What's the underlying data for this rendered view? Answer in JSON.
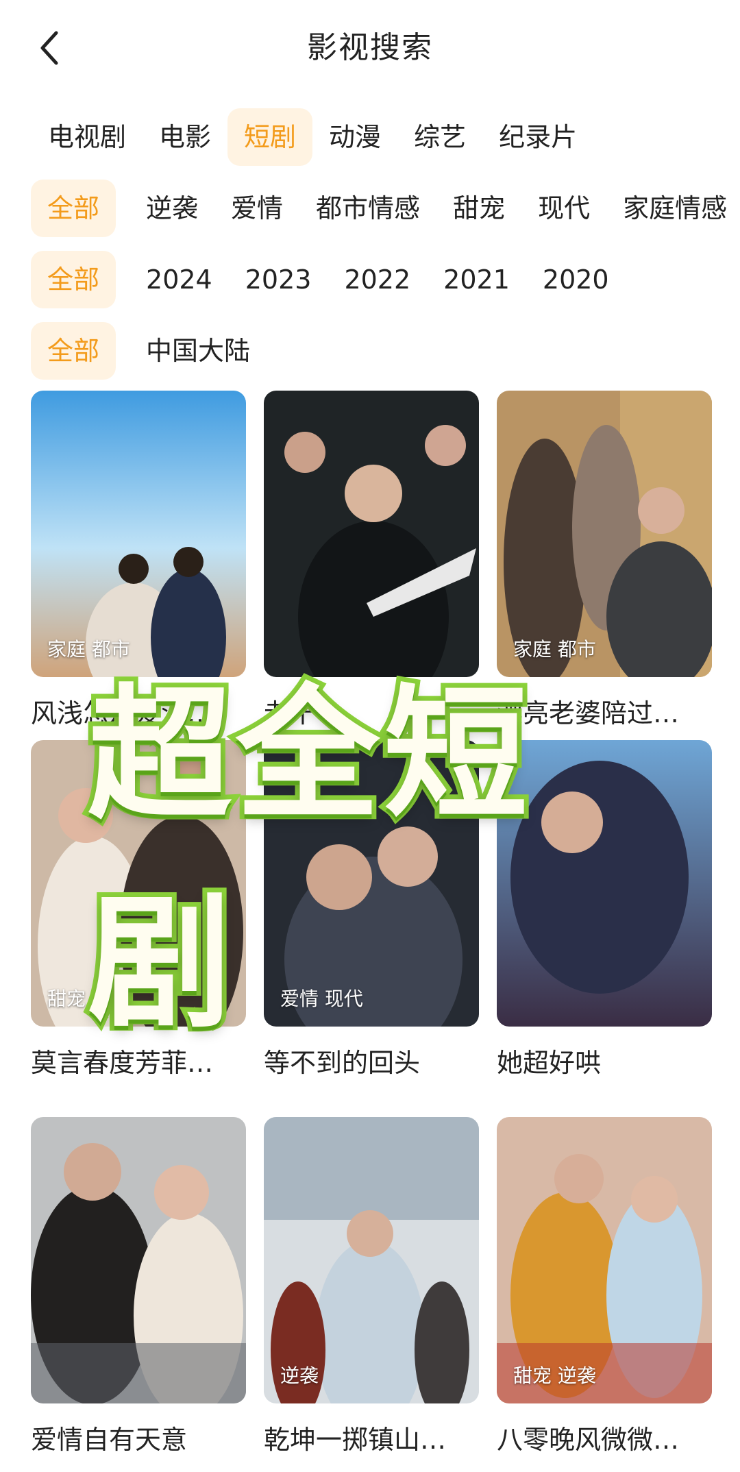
{
  "header": {
    "title": "影视搜索",
    "back_icon": "chevron-left-icon"
  },
  "category_tabs": [
    "电视剧",
    "电影",
    "短剧",
    "动漫",
    "综艺",
    "纪录片"
  ],
  "category_selected": "短剧",
  "genre_filters": [
    "全部",
    "逆袭",
    "爱情",
    "都市情感",
    "甜宠",
    "现代",
    "家庭情感"
  ],
  "year_filters": [
    "全部",
    "2024",
    "2023",
    "2022",
    "2021",
    "2020"
  ],
  "region_filters": [
    "全部",
    "中国大陆"
  ],
  "accent_color": "#f39b1b",
  "items": [
    {
      "title": "风浅怎及爱深…",
      "tags": "家庭 都市"
    },
    {
      "title": "老千",
      "tags": ""
    },
    {
      "title": "漂亮老婆陪过…",
      "tags": "家庭 都市"
    },
    {
      "title": "莫言春度芳菲…",
      "tags": "甜宠 逆袭"
    },
    {
      "title": "等不到的回头",
      "tags": "爱情 现代"
    },
    {
      "title": "她超好哄",
      "tags": ""
    },
    {
      "title": "爱情自有天意",
      "tags": ""
    },
    {
      "title": "乾坤一掷镇山…",
      "tags": "逆袭"
    },
    {
      "title": "八零晚风微微…",
      "tags": "甜宠 逆袭"
    }
  ],
  "overlay_text": "超全短剧"
}
